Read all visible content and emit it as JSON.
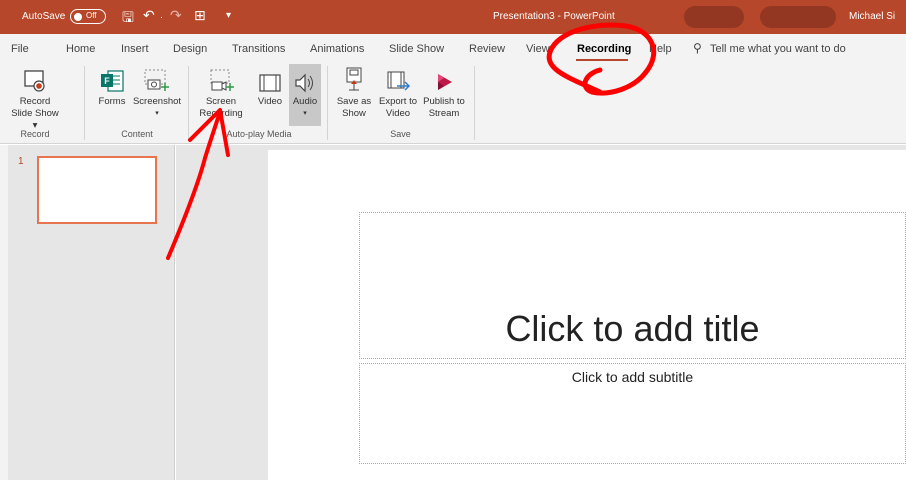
{
  "titlebar": {
    "autosave_label": "AutoSave",
    "autosave_state": "Off",
    "document_title": "Presentation3 - PowerPoint",
    "user_name": "Michael Si"
  },
  "tabs": [
    "File",
    "Home",
    "Insert",
    "Design",
    "Transitions",
    "Animations",
    "Slide Show",
    "Review",
    "View",
    "Recording",
    "Help"
  ],
  "active_tab": "Recording",
  "tell_me": "Tell me what you want to do",
  "ribbon": {
    "record_slide_show": "Record Slide Show ▾",
    "forms": "Forms",
    "screenshot": "Screenshot",
    "screenshot_arrow": "▾",
    "screen_recording": "Screen Recording",
    "video": "Video",
    "audio": "Audio",
    "audio_arrow": "▾",
    "save_as_show": "Save as Show",
    "export_to_video": "Export to Video",
    "publish_to_stream": "Publish to Stream",
    "groups": {
      "record": "Record",
      "content": "Content",
      "autoplay": "Auto-play Media",
      "save": "Save"
    }
  },
  "slide_pane": {
    "slide_number": "1"
  },
  "slide": {
    "title_placeholder": "Click to add title",
    "subtitle_placeholder": "Click to add subtitle"
  },
  "colors": {
    "accent": "#b7472a",
    "annotation": "#ff0000"
  }
}
